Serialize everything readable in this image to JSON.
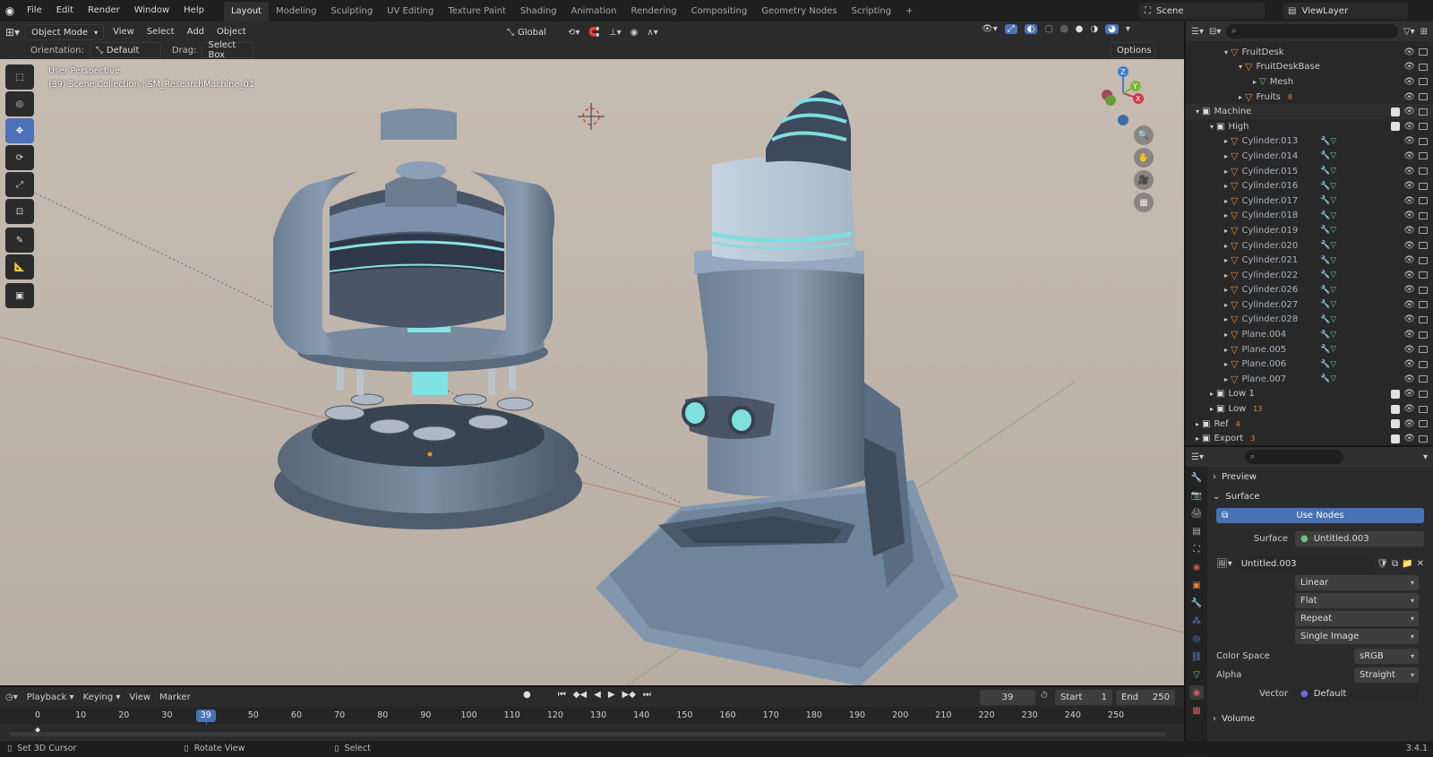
{
  "menu": {
    "file": "File",
    "edit": "Edit",
    "render": "Render",
    "window": "Window",
    "help": "Help"
  },
  "workspaces": [
    "Layout",
    "Modeling",
    "Sculpting",
    "UV Editing",
    "Texture Paint",
    "Shading",
    "Animation",
    "Rendering",
    "Compositing",
    "Geometry Nodes",
    "Scripting"
  ],
  "scene": {
    "name": "Scene",
    "view_layer": "ViewLayer"
  },
  "header": {
    "mode": "Object Mode",
    "view": "View",
    "select": "Select",
    "add": "Add",
    "object": "Object",
    "transform": "Global",
    "orientation_label": "Orientation:",
    "orientation_value": "Default",
    "drag_label": "Drag:",
    "drag_value": "Select Box",
    "options": "Options"
  },
  "viewport": {
    "perspective": "User Perspective",
    "collection": "(39) Scene Collection | SM_ResearchMachine_01",
    "gizmo_z": "Z",
    "gizmo_y": "Y",
    "gizmo_x": "X"
  },
  "outliner": {
    "rows": [
      {
        "label": "FruitDesk",
        "depth": 2,
        "kind": "obj"
      },
      {
        "label": "FruitDeskBase",
        "depth": 3,
        "kind": "obj"
      },
      {
        "label": "Mesh",
        "depth": 4,
        "kind": "mesh"
      },
      {
        "label": "Fruits",
        "depth": 3,
        "kind": "obj",
        "badge": "8"
      },
      {
        "label": "Machine",
        "depth": 0,
        "kind": "coll"
      },
      {
        "label": "High",
        "depth": 1,
        "kind": "coll"
      },
      {
        "label": "Cylinder.013",
        "depth": 2,
        "kind": "obj"
      },
      {
        "label": "Cylinder.014",
        "depth": 2,
        "kind": "obj"
      },
      {
        "label": "Cylinder.015",
        "depth": 2,
        "kind": "obj"
      },
      {
        "label": "Cylinder.016",
        "depth": 2,
        "kind": "obj"
      },
      {
        "label": "Cylinder.017",
        "depth": 2,
        "kind": "obj"
      },
      {
        "label": "Cylinder.018",
        "depth": 2,
        "kind": "obj"
      },
      {
        "label": "Cylinder.019",
        "depth": 2,
        "kind": "obj"
      },
      {
        "label": "Cylinder.020",
        "depth": 2,
        "kind": "obj"
      },
      {
        "label": "Cylinder.021",
        "depth": 2,
        "kind": "obj"
      },
      {
        "label": "Cylinder.022",
        "depth": 2,
        "kind": "obj"
      },
      {
        "label": "Cylinder.026",
        "depth": 2,
        "kind": "obj"
      },
      {
        "label": "Cylinder.027",
        "depth": 2,
        "kind": "obj"
      },
      {
        "label": "Cylinder.028",
        "depth": 2,
        "kind": "obj"
      },
      {
        "label": "Plane.004",
        "depth": 2,
        "kind": "obj"
      },
      {
        "label": "Plane.005",
        "depth": 2,
        "kind": "obj"
      },
      {
        "label": "Plane.006",
        "depth": 2,
        "kind": "obj"
      },
      {
        "label": "Plane.007",
        "depth": 2,
        "kind": "obj"
      },
      {
        "label": "Low 1",
        "depth": 1,
        "kind": "coll"
      },
      {
        "label": "Low",
        "depth": 1,
        "kind": "coll",
        "badge": "13"
      },
      {
        "label": "Ref",
        "depth": 0,
        "kind": "coll",
        "badge": "4"
      },
      {
        "label": "Export",
        "depth": 0,
        "kind": "coll",
        "badge": "3"
      }
    ]
  },
  "properties": {
    "preview": "Preview",
    "surface_panel": "Surface",
    "use_nodes": "Use Nodes",
    "surface_label": "Surface",
    "surface_value": "Untitled.003",
    "image_name": "Untitled.003",
    "interp": "Linear",
    "projection": "Flat",
    "extension": "Repeat",
    "source": "Single Image",
    "color_space_label": "Color Space",
    "color_space": "sRGB",
    "alpha_label": "Alpha",
    "alpha": "Straight",
    "vector_label": "Vector",
    "vector": "Default",
    "volume": "Volume"
  },
  "timeline": {
    "playback": "Playback",
    "keying": "Keying",
    "view": "View",
    "marker": "Marker",
    "current_frame": "39",
    "start_label": "Start",
    "start": "1",
    "end_label": "End",
    "end": "250",
    "ticks": [
      "0",
      "10",
      "20",
      "30",
      "39",
      "50",
      "60",
      "70",
      "80",
      "90",
      "100",
      "110",
      "120",
      "130",
      "140",
      "150",
      "160",
      "170",
      "180",
      "190",
      "200",
      "210",
      "220",
      "230",
      "240",
      "250"
    ]
  },
  "status": {
    "left": "Set 3D Cursor",
    "mid": "Rotate View",
    "right": "Select",
    "version": "3.4.1"
  }
}
